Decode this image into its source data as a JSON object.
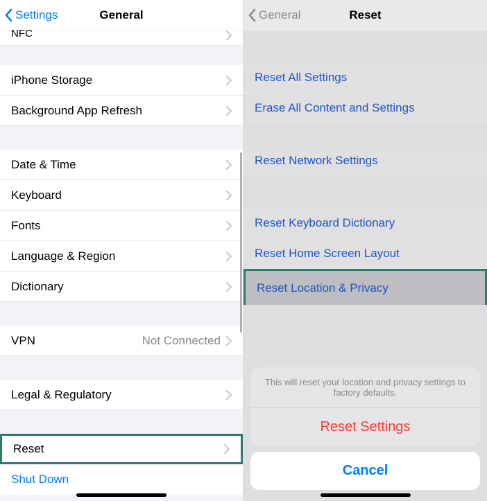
{
  "left": {
    "back_label": "Settings",
    "title": "General",
    "nfc": "NFC",
    "iphone_storage": "iPhone Storage",
    "background_refresh": "Background App Refresh",
    "date_time": "Date & Time",
    "keyboard": "Keyboard",
    "fonts": "Fonts",
    "language_region": "Language & Region",
    "dictionary": "Dictionary",
    "vpn": "VPN",
    "vpn_status": "Not Connected",
    "legal": "Legal & Regulatory",
    "reset": "Reset",
    "shut_down": "Shut Down"
  },
  "right": {
    "back_label": "General",
    "title": "Reset",
    "reset_all": "Reset All Settings",
    "erase_all": "Erase All Content and Settings",
    "reset_network": "Reset Network Settings",
    "reset_keyboard": "Reset Keyboard Dictionary",
    "reset_home": "Reset Home Screen Layout",
    "reset_location": "Reset Location & Privacy",
    "sheet_msg": "This will reset your location and privacy settings to factory defaults.",
    "sheet_action": "Reset Settings",
    "sheet_cancel": "Cancel"
  }
}
